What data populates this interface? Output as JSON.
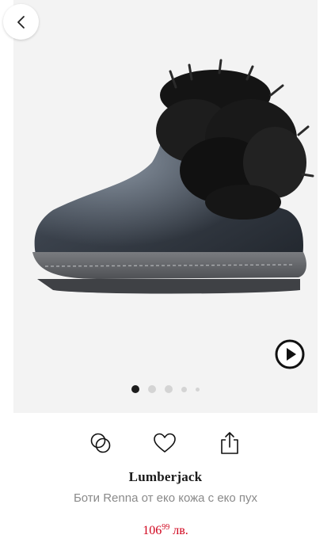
{
  "navigation": {
    "back_icon": "chevron-left-icon"
  },
  "gallery": {
    "image_description": "dark metallic ankle boot with black faux fur cuff",
    "play_icon": "play-circle-icon",
    "slide_count": 5,
    "active_slide": 1
  },
  "actions": {
    "compare_icon": "compare-rings-icon",
    "favorite_icon": "heart-icon",
    "share_icon": "share-icon"
  },
  "product": {
    "brand": "Lumberjack",
    "name": "Боти Renna от еко кожа с еко пух",
    "price_whole": "106",
    "price_fraction": "99",
    "currency": "лв."
  },
  "colors": {
    "price": "#d0021b",
    "brand": "#1a1a1a",
    "name": "#8a8a8a",
    "gallery_bg": "#f3f3f3"
  }
}
